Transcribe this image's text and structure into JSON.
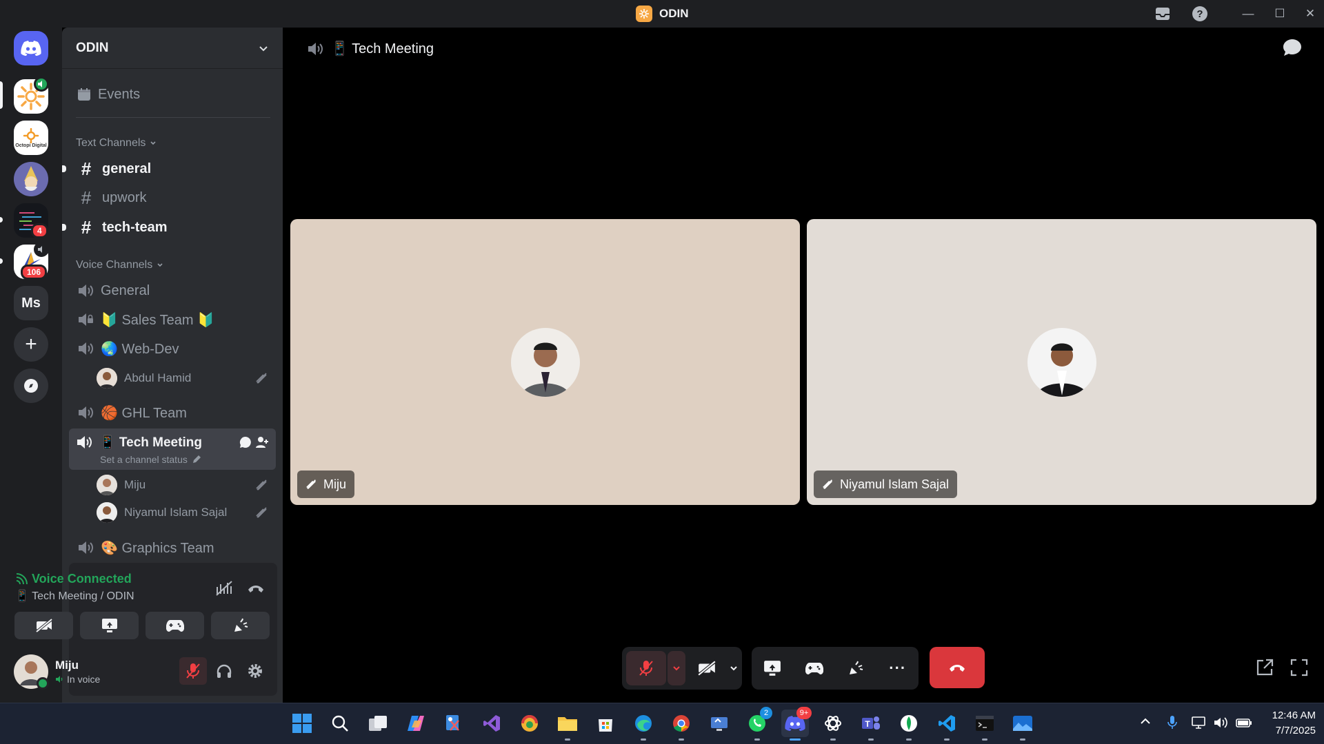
{
  "window": {
    "title": "ODIN",
    "min_glyph": "—",
    "max_glyph": "☐",
    "close_glyph": "✕"
  },
  "server_rail": {
    "servers": [
      {
        "name": "odin-server",
        "icon": "flower-logo",
        "badge": "",
        "active": true
      },
      {
        "name": "octopi-digital",
        "icon": "octopi-logo",
        "label": "Octopi Digital"
      },
      {
        "name": "wizard-server",
        "icon": "wizard-avatar"
      },
      {
        "name": "code-server",
        "icon": "code-image",
        "badge": "4"
      },
      {
        "name": "arrow-server",
        "icon": "arrow-logo",
        "badge": "106"
      },
      {
        "name": "ms-server",
        "label": "Ms"
      }
    ],
    "add_server_glyph": "+",
    "discover_glyph": "⌾"
  },
  "sidebar": {
    "server_name": "ODIN",
    "events_label": "Events",
    "text_category": "Text Channels",
    "text_channels": [
      {
        "name": "general",
        "unread": true
      },
      {
        "name": "upwork",
        "unread": false
      },
      {
        "name": "tech-team",
        "unread": true
      }
    ],
    "voice_category": "Voice Channels",
    "voice_channels": {
      "general": "General",
      "sales": "🔰 Sales Team 🔰",
      "webdev": "🌏 Web-Dev",
      "webdev_user": "Abdul Hamid",
      "ghl": "🏀 GHL Team",
      "tech": "📱 Tech Meeting",
      "tech_status": "Set a channel status",
      "tech_user1": "Miju",
      "tech_user2": "Niyamul Islam Sajal",
      "graphics": "🎨 Graphics Team"
    }
  },
  "voice_panel": {
    "status": "Voice Connected",
    "location": "📱 Tech Meeting / ODIN"
  },
  "user_panel": {
    "name": "Miju",
    "status": "In voice"
  },
  "call": {
    "title": "📱 Tech Meeting",
    "participants": [
      {
        "name": "Miju",
        "tile_color": "#dfd0c2"
      },
      {
        "name": "Niyamul Islam Sajal",
        "tile_color": "#e2dcd6"
      }
    ],
    "more_glyph": "···"
  },
  "taskbar": {
    "time": "12:46 AM",
    "date": "7/7/2025",
    "discord_badge": "9+",
    "whatsapp_badge": "2"
  },
  "colors": {
    "accent_red": "#da373c",
    "green": "#23a55a",
    "blurple": "#5865f2"
  }
}
